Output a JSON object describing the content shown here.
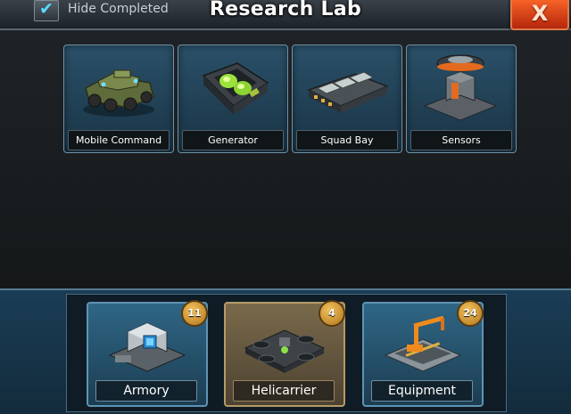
{
  "header": {
    "title": "Research Lab",
    "hide_completed_label": "Hide Completed",
    "hide_completed_checked": true,
    "close_label": "X"
  },
  "research_items": [
    {
      "label": "Mobile Command",
      "icon": "mobile-command-vehicle-icon"
    },
    {
      "label": "Generator",
      "icon": "generator-icon"
    },
    {
      "label": "Squad Bay",
      "icon": "squad-bay-icon"
    },
    {
      "label": "Sensors",
      "icon": "sensors-tower-icon"
    }
  ],
  "categories": [
    {
      "label": "Armory",
      "count": "11",
      "icon": "armory-icon",
      "selected": false
    },
    {
      "label": "Helicarrier",
      "count": "4",
      "icon": "helicarrier-icon",
      "selected": true
    },
    {
      "label": "Equipment",
      "count": "24",
      "icon": "equipment-crane-icon",
      "selected": false
    }
  ],
  "colors": {
    "accent_blue": "#2a5068",
    "selected_tab": "#7a6a4b",
    "close_button": "#e0461a",
    "badge": "#d19a3c",
    "checkmark": "#58dbff"
  }
}
